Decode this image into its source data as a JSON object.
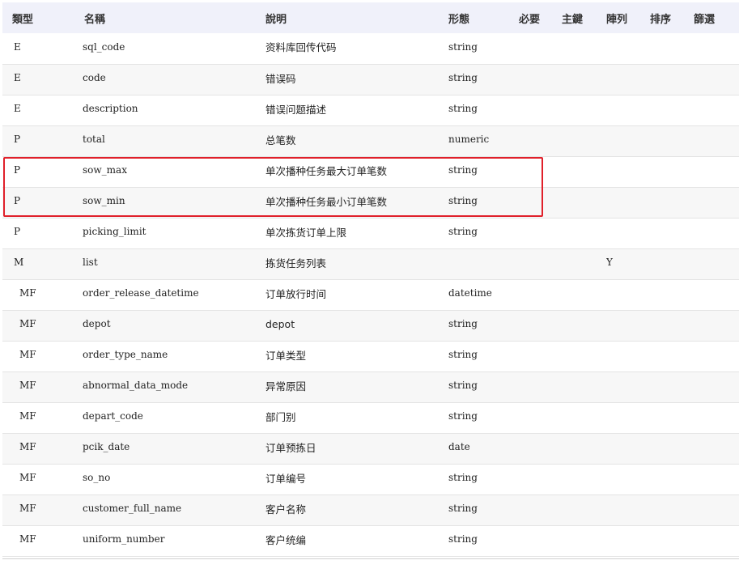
{
  "headers": {
    "type": "類型",
    "name": "名稱",
    "desc": "說明",
    "form": "形態",
    "required": "必要",
    "key": "主鍵",
    "array": "陣列",
    "sort": "排序",
    "filter": "篩選"
  },
  "rows": [
    {
      "type": "E",
      "name": "sql_code",
      "desc": "资料库回传代码",
      "form": "string",
      "required": "",
      "key": "",
      "array": "",
      "sort": "",
      "filter": ""
    },
    {
      "type": "E",
      "name": "code",
      "desc": "错误码",
      "form": "string",
      "required": "",
      "key": "",
      "array": "",
      "sort": "",
      "filter": ""
    },
    {
      "type": "E",
      "name": "description",
      "desc": "错误问题描述",
      "form": "string",
      "required": "",
      "key": "",
      "array": "",
      "sort": "",
      "filter": ""
    },
    {
      "type": "P",
      "name": "total",
      "desc": "总笔数",
      "form": "numeric",
      "required": "",
      "key": "",
      "array": "",
      "sort": "",
      "filter": ""
    },
    {
      "type": "P",
      "name": "sow_max",
      "desc": "单次播种任务最大订单笔数",
      "form": "string",
      "required": "",
      "key": "",
      "array": "",
      "sort": "",
      "filter": ""
    },
    {
      "type": "P",
      "name": "sow_min",
      "desc": "单次播种任务最小订单笔数",
      "form": "string",
      "required": "",
      "key": "",
      "array": "",
      "sort": "",
      "filter": ""
    },
    {
      "type": "P",
      "name": "picking_limit",
      "desc": "单次拣货订单上限",
      "form": "string",
      "required": "",
      "key": "",
      "array": "",
      "sort": "",
      "filter": ""
    },
    {
      "type": "M",
      "name": "list",
      "desc": "拣货任务列表",
      "form": "",
      "required": "",
      "key": "",
      "array": "Y",
      "sort": "",
      "filter": ""
    },
    {
      "type": "MF",
      "name": "order_release_datetime",
      "desc": "订单放行时间",
      "form": "datetime",
      "required": "",
      "key": "",
      "array": "",
      "sort": "",
      "filter": ""
    },
    {
      "type": "MF",
      "name": "depot",
      "desc": "depot",
      "form": "string",
      "required": "",
      "key": "",
      "array": "",
      "sort": "",
      "filter": ""
    },
    {
      "type": "MF",
      "name": "order_type_name",
      "desc": "订单类型",
      "form": "string",
      "required": "",
      "key": "",
      "array": "",
      "sort": "",
      "filter": ""
    },
    {
      "type": "MF",
      "name": "abnormal_data_mode",
      "desc": "异常原因",
      "form": "string",
      "required": "",
      "key": "",
      "array": "",
      "sort": "",
      "filter": ""
    },
    {
      "type": "MF",
      "name": "depart_code",
      "desc": "部门别",
      "form": "string",
      "required": "",
      "key": "",
      "array": "",
      "sort": "",
      "filter": ""
    },
    {
      "type": "MF",
      "name": "pcik_date",
      "desc": "订单预拣日",
      "form": "date",
      "required": "",
      "key": "",
      "array": "",
      "sort": "",
      "filter": ""
    },
    {
      "type": "MF",
      "name": "so_no",
      "desc": "订单编号",
      "form": "string",
      "required": "",
      "key": "",
      "array": "",
      "sort": "",
      "filter": ""
    },
    {
      "type": "MF",
      "name": "customer_full_name",
      "desc": "客户名称",
      "form": "string",
      "required": "",
      "key": "",
      "array": "",
      "sort": "",
      "filter": ""
    },
    {
      "type": "MF",
      "name": "uniform_number",
      "desc": "客户统编",
      "form": "string",
      "required": "",
      "key": "",
      "array": "",
      "sort": "",
      "filter": ""
    }
  ],
  "highlight_color": "#e0202a"
}
